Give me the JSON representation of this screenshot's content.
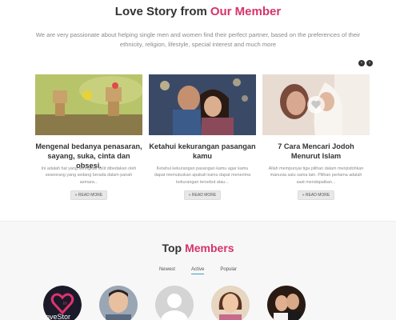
{
  "stories": {
    "title_main": "Love Story from",
    "title_accent": "Our Member",
    "intro": "We are very passionate about helping single men and women find their perfect partner, based on the preferences of their ethnicity, religion, lifestyle, special interest and much more",
    "prev_glyph": "‹",
    "next_glyph": "›",
    "cards": [
      {
        "title": "Mengenal bedanya penasaran, sayang, suka, cinta dan obsesi.",
        "excerpt": "Ini adalah hal yang seringkali sulit dibedakan oleh seseorang yang sedang berada dalam panah asmara...",
        "button": "» READ MORE"
      },
      {
        "title": "Ketahui kekurangan pasangan kamu",
        "excerpt": "Ketahui kekurangan pasangan kamu agar kamu dapat memutuskan apakah kamu dapat menerima kekurangan tersebut atau...",
        "button": "» READ MORE"
      },
      {
        "title": "7 Cara Mencari Jodoh Menurut Islam",
        "excerpt": "Allah mempunyai tiga pilihan dalam menjodohkan manusia satu sama lain. Pilihan pertama adalah saat mendapatkan...",
        "button": "» READ MORE"
      }
    ]
  },
  "members": {
    "title_main": "Top",
    "title_accent": "Members",
    "tabs": [
      "Newest",
      "Active",
      "Popular"
    ],
    "active_tab": "Active",
    "logo_text": "oveStor",
    "logo_in": "in"
  },
  "colors": {
    "accent": "#d6336c",
    "tab_underline": "#3aa0c0"
  }
}
